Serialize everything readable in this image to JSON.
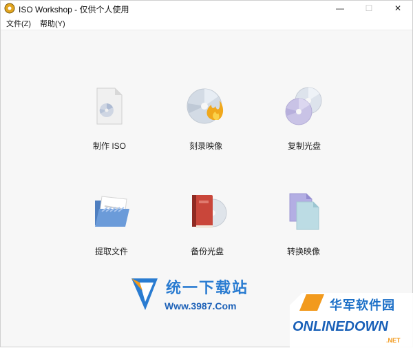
{
  "window": {
    "title": "ISO Workshop - 仅供个人使用",
    "controls": {
      "minimize": "—",
      "maximize": "☐",
      "close": "✕"
    }
  },
  "menu": [
    {
      "label": "文件(Z)"
    },
    {
      "label": "帮助(Y)"
    }
  ],
  "tools": [
    {
      "label": "制作 ISO",
      "icon": "make-iso-icon"
    },
    {
      "label": "刻录映像",
      "icon": "burn-image-icon"
    },
    {
      "label": "复制光盘",
      "icon": "copy-disc-icon"
    },
    {
      "label": "提取文件",
      "icon": "extract-files-icon"
    },
    {
      "label": "备份光盘",
      "icon": "backup-disc-icon"
    },
    {
      "label": "转换映像",
      "icon": "convert-image-icon"
    }
  ],
  "watermarks": {
    "left_cn": "统一下载站",
    "left_en": "Www.3987.Com",
    "right_cn": "华军软件园",
    "right_en": "ONLINEDOWN",
    "right_suffix": ".NET"
  },
  "colors": {
    "accent": "#2a7cd1",
    "watermark_orange": "#f29a1d"
  }
}
